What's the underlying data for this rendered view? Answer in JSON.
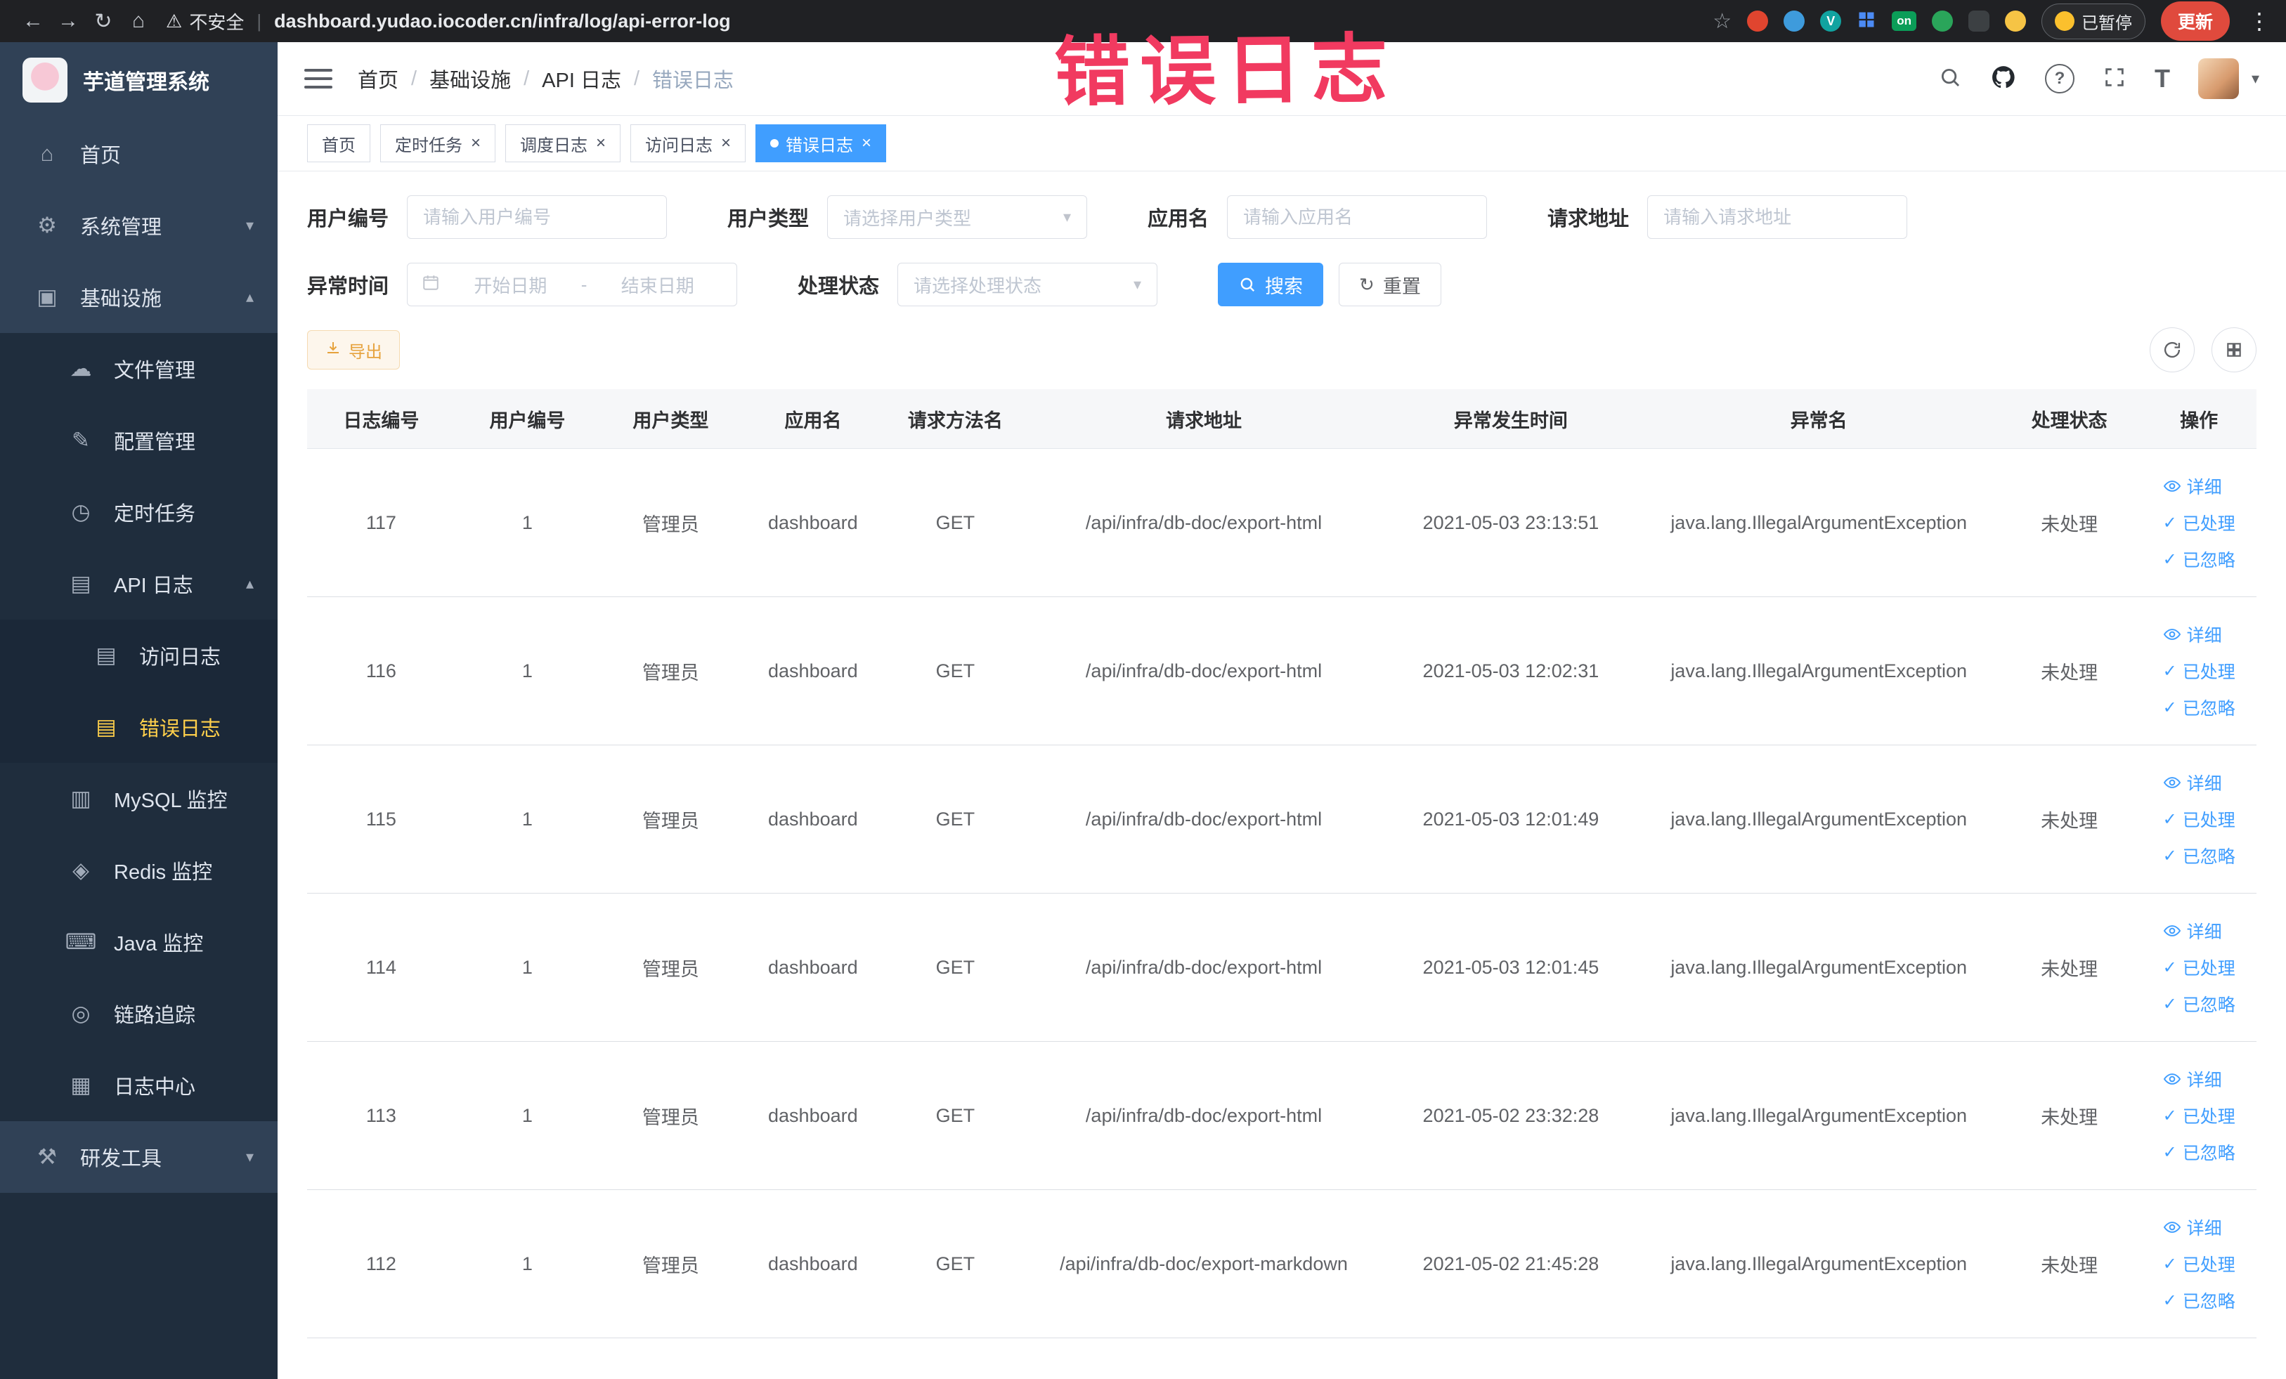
{
  "browser": {
    "security_label": "不安全",
    "url": "dashboard.yudao.iocoder.cn/infra/log/api-error-log",
    "paused_label": "已暂停",
    "update_label": "更新",
    "badges": {
      "v": "V",
      "on": "on"
    }
  },
  "icons": {
    "back": "←",
    "forward": "→",
    "reload": "↻",
    "home": "⌂",
    "star": "☆",
    "warning": "⚠",
    "kebab": "⋮",
    "chevron_down": "▾",
    "chevron_up": "▴",
    "caret_down": "▾",
    "check": "✓",
    "question": "?",
    "font_size": "T"
  },
  "annotation": {
    "text": "错误日志"
  },
  "sidebar": {
    "logo_title": "芋道管理系统",
    "items": [
      {
        "name": "home",
        "label": "首页",
        "glyph": "⌂",
        "level": 0
      },
      {
        "name": "system-mgmt",
        "label": "系统管理",
        "glyph": "⚙",
        "level": 0,
        "arrow": "down"
      },
      {
        "name": "infrastructure",
        "label": "基础设施",
        "glyph": "▣",
        "level": 0,
        "arrow": "up"
      },
      {
        "name": "file-mgmt",
        "label": "文件管理",
        "glyph": "☁",
        "level": 1
      },
      {
        "name": "config-mgmt",
        "label": "配置管理",
        "glyph": "✎",
        "level": 1
      },
      {
        "name": "scheduled-tasks",
        "label": "定时任务",
        "glyph": "◷",
        "level": 1
      },
      {
        "name": "api-logs",
        "label": "API 日志",
        "glyph": "▤",
        "level": 1,
        "arrow": "up"
      },
      {
        "name": "access-log",
        "label": "访问日志",
        "glyph": "▤",
        "level": 2
      },
      {
        "name": "error-log",
        "label": "错误日志",
        "glyph": "▤",
        "level": 2,
        "active": true
      },
      {
        "name": "mysql-monitor",
        "label": "MySQL 监控",
        "glyph": "▥",
        "level": 1
      },
      {
        "name": "redis-monitor",
        "label": "Redis 监控",
        "glyph": "◈",
        "level": 1
      },
      {
        "name": "java-monitor",
        "label": "Java 监控",
        "glyph": "⌨",
        "level": 1
      },
      {
        "name": "link-trace",
        "label": "链路追踪",
        "glyph": "◎",
        "level": 1
      },
      {
        "name": "log-center",
        "label": "日志中心",
        "glyph": "▦",
        "level": 1
      },
      {
        "name": "dev-tools",
        "label": "研发工具",
        "glyph": "⚒",
        "level": 0,
        "arrow": "down"
      }
    ]
  },
  "header": {
    "breadcrumb": [
      "首页",
      "基础设施",
      "API 日志",
      "错误日志"
    ]
  },
  "tabs": [
    {
      "name": "home",
      "label": "首页",
      "closable": false,
      "active": false
    },
    {
      "name": "scheduled-tasks",
      "label": "定时任务",
      "closable": true,
      "active": false
    },
    {
      "name": "schedule-log",
      "label": "调度日志",
      "closable": true,
      "active": false
    },
    {
      "name": "access-log",
      "label": "访问日志",
      "closable": true,
      "active": false
    },
    {
      "name": "error-log",
      "label": "错误日志",
      "closable": true,
      "active": true
    }
  ],
  "filters": {
    "user_id_label": "用户编号",
    "user_id_placeholder": "请输入用户编号",
    "user_type_label": "用户类型",
    "user_type_placeholder": "请选择用户类型",
    "app_name_label": "应用名",
    "app_name_placeholder": "请输入应用名",
    "request_url_label": "请求地址",
    "request_url_placeholder": "请输入请求地址",
    "exception_time_label": "异常时间",
    "start_date_placeholder": "开始日期",
    "end_date_placeholder": "结束日期",
    "date_separator": "-",
    "process_status_label": "处理状态",
    "process_status_placeholder": "请选择处理状态",
    "search_label": "搜索",
    "reset_label": "重置"
  },
  "toolbar": {
    "export_label": "导出"
  },
  "table": {
    "columns": [
      "日志编号",
      "用户编号",
      "用户类型",
      "应用名",
      "请求方法名",
      "请求地址",
      "异常发生时间",
      "异常名",
      "处理状态",
      "操作"
    ],
    "actions": [
      {
        "name": "detail",
        "label": "详细",
        "icon": "eye"
      },
      {
        "name": "processed",
        "label": "已处理",
        "icon": "check"
      },
      {
        "name": "ignored",
        "label": "已忽略",
        "icon": "check"
      }
    ],
    "rows": [
      {
        "id": "117",
        "user_id": "1",
        "user_type": "管理员",
        "app": "dashboard",
        "method": "GET",
        "url": "/api/infra/db-doc/export-html",
        "time": "2021-05-03 23:13:51",
        "exception": "java.lang.IllegalArgumentException",
        "status": "未处理"
      },
      {
        "id": "116",
        "user_id": "1",
        "user_type": "管理员",
        "app": "dashboard",
        "method": "GET",
        "url": "/api/infra/db-doc/export-html",
        "time": "2021-05-03 12:02:31",
        "exception": "java.lang.IllegalArgumentException",
        "status": "未处理"
      },
      {
        "id": "115",
        "user_id": "1",
        "user_type": "管理员",
        "app": "dashboard",
        "method": "GET",
        "url": "/api/infra/db-doc/export-html",
        "time": "2021-05-03 12:01:49",
        "exception": "java.lang.IllegalArgumentException",
        "status": "未处理"
      },
      {
        "id": "114",
        "user_id": "1",
        "user_type": "管理员",
        "app": "dashboard",
        "method": "GET",
        "url": "/api/infra/db-doc/export-html",
        "time": "2021-05-03 12:01:45",
        "exception": "java.lang.IllegalArgumentException",
        "status": "未处理"
      },
      {
        "id": "113",
        "user_id": "1",
        "user_type": "管理员",
        "app": "dashboard",
        "method": "GET",
        "url": "/api/infra/db-doc/export-html",
        "time": "2021-05-02 23:32:28",
        "exception": "java.lang.IllegalArgumentException",
        "status": "未处理"
      },
      {
        "id": "112",
        "user_id": "1",
        "user_type": "管理员",
        "app": "dashboard",
        "method": "GET",
        "url": "/api/infra/db-doc/export-markdown",
        "time": "2021-05-02 21:45:28",
        "exception": "java.lang.IllegalArgumentException",
        "status": "未处理"
      }
    ]
  }
}
